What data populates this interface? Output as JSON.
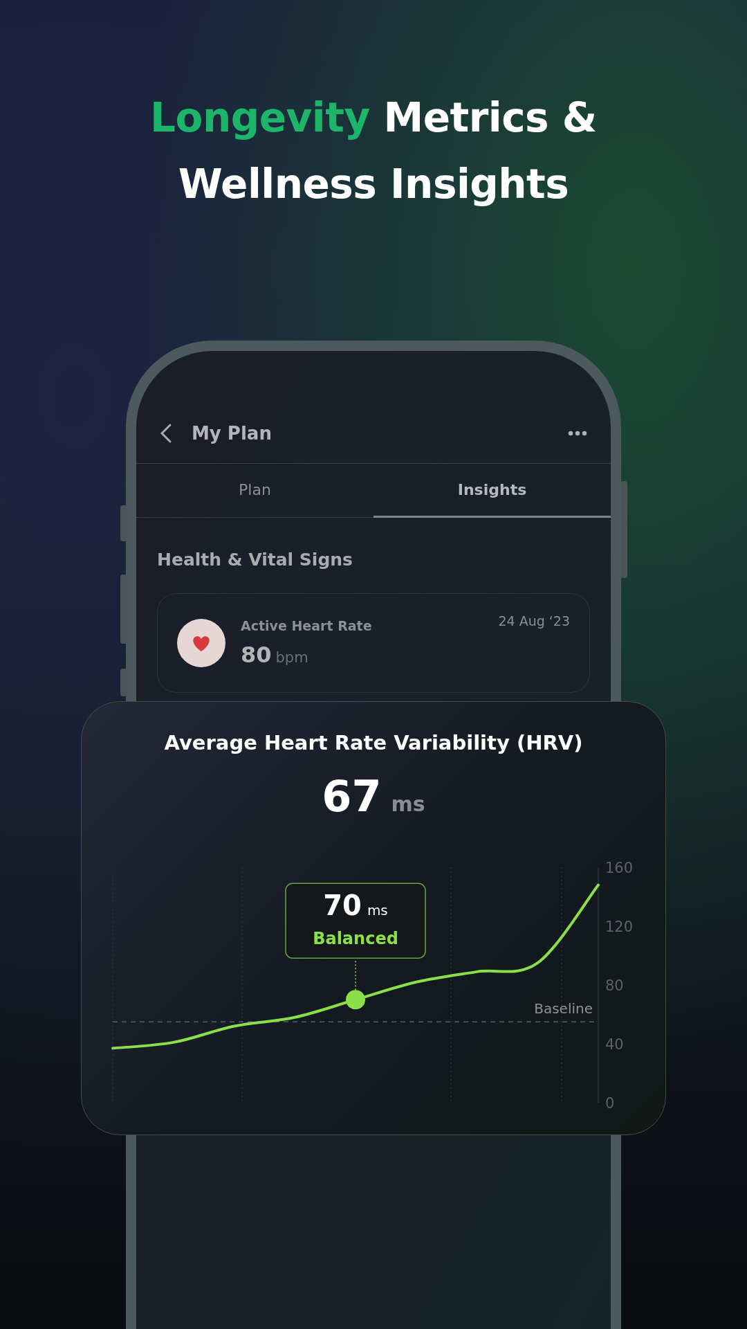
{
  "headline": {
    "highlight": "Longevity",
    "rest": "Metrics &",
    "line2": "Wellness Insights"
  },
  "screen": {
    "title": "My Plan",
    "tabs": [
      {
        "label": "Plan",
        "selected": false
      },
      {
        "label": "Insights",
        "selected": true
      }
    ],
    "section_title": "Health & Vital Signs",
    "metric_card": {
      "label": "Active Heart Rate",
      "date": "24 Aug ‘23",
      "value": "80",
      "unit": "bpm"
    }
  },
  "hrv_card": {
    "title": "Average Heart Rate Variability (HRV)",
    "value": "67",
    "unit": "ms",
    "chart_data": {
      "type": "line",
      "ylim": [
        0,
        160
      ],
      "yticks": [
        0,
        40,
        80,
        120,
        160
      ],
      "series": [
        {
          "color": "#8be04a",
          "values": [
            37,
            41,
            52,
            58,
            70,
            82,
            89,
            95,
            148
          ]
        }
      ],
      "ref_lines": [
        {
          "axis": "y",
          "value": 55,
          "label": "Baseline"
        }
      ]
    },
    "tooltip": {
      "value": "70",
      "unit": "ms",
      "status": "Balanced"
    }
  }
}
